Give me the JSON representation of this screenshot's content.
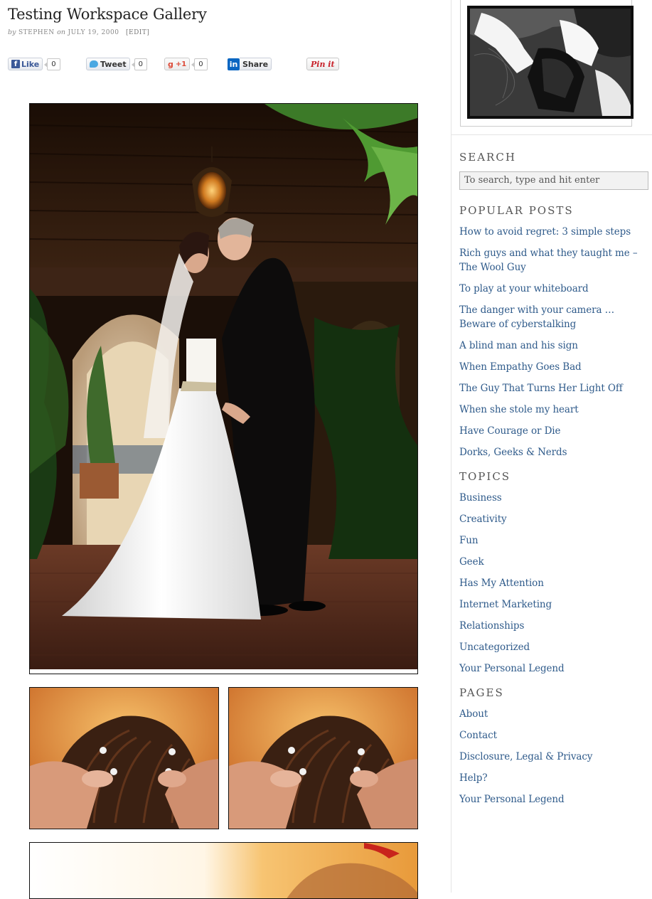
{
  "post": {
    "title": "Testing Workspace Gallery",
    "meta_by": "by",
    "author": "STEPHEN",
    "meta_on": "on",
    "date": "JULY 19, 2000",
    "edit": "[EDIT]"
  },
  "share": {
    "facebook": {
      "label": "Like",
      "count": "0"
    },
    "twitter": {
      "label": "Tweet",
      "count": "0"
    },
    "google": {
      "label": "+1",
      "count": "0"
    },
    "linkedin": {
      "label": "Share"
    },
    "pinterest": {
      "label": "Pin it"
    }
  },
  "sidebar": {
    "search": {
      "heading": "SEARCH",
      "placeholder": "To search, type and hit enter"
    },
    "popular": {
      "heading": "POPULAR POSTS",
      "items": [
        "How to avoid regret: 3 simple steps",
        "Rich guys and what they taught me – The Wool Guy",
        "To play at your whiteboard",
        "The danger with your camera … Beware of cyberstalking",
        "A blind man and his sign",
        "When Empathy Goes Bad",
        "The Guy That Turns Her Light Off",
        "When she stole my heart",
        "Have Courage or Die",
        "Dorks, Geeks & Nerds"
      ]
    },
    "topics": {
      "heading": "TOPICS",
      "items": [
        "Business",
        "Creativity",
        "Fun",
        "Geek",
        "Has My Attention",
        "Internet Marketing",
        "Relationships",
        "Uncategorized",
        "Your Personal Legend"
      ]
    },
    "pages": {
      "heading": "PAGES",
      "items": [
        "About",
        "Contact",
        "Disclosure, Legal & Privacy",
        "Help?",
        "Your Personal Legend"
      ]
    }
  },
  "colors": {
    "link": "#2e5a8a",
    "heading": "#555555",
    "facebook": "#3b5998",
    "pinterest": "#c8232c"
  },
  "icons": [
    "facebook-icon",
    "twitter-icon",
    "google-plus-icon",
    "linkedin-icon",
    "pinterest-icon"
  ]
}
